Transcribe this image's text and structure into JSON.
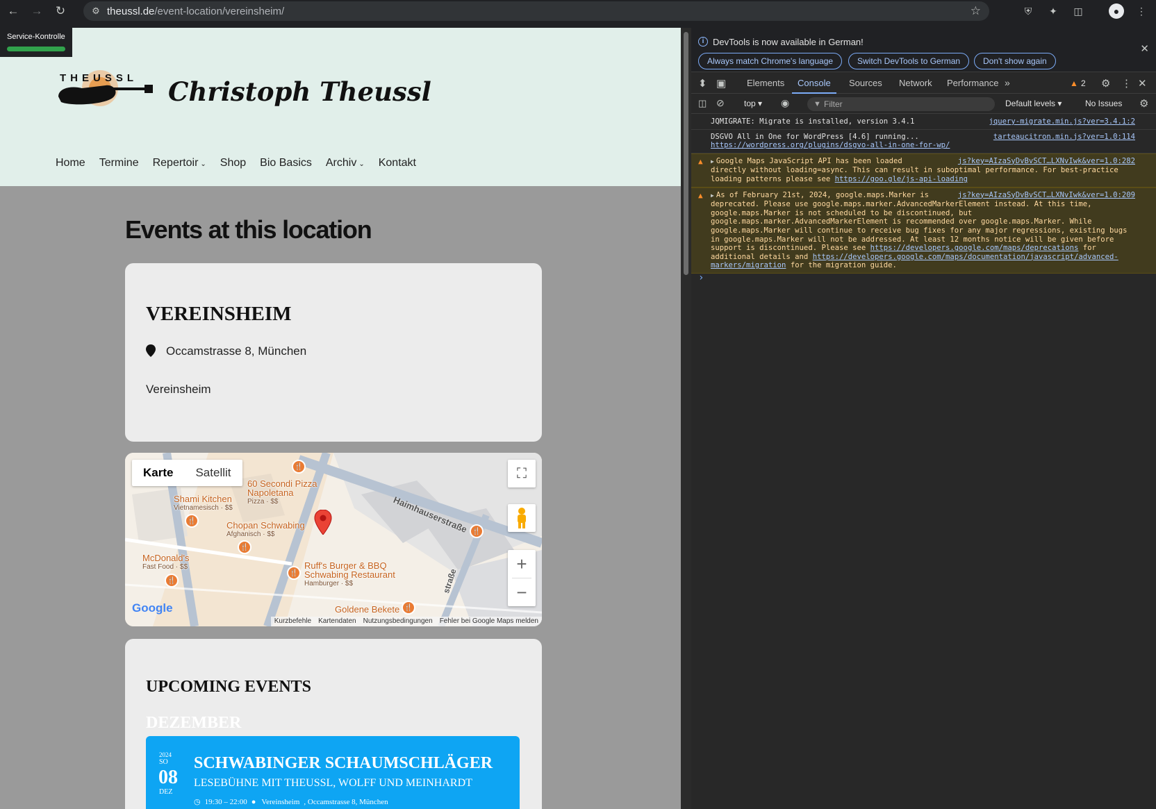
{
  "browser": {
    "url_host": "theussl.de",
    "url_path": "/event-location/vereinsheim/"
  },
  "service_control": {
    "label": "Service-Kontrolle"
  },
  "site": {
    "logo_text": "THEUSSL",
    "title": "Christoph Theussl",
    "nav": [
      "Home",
      "Termine",
      "Repertoir",
      "Shop",
      "Bio Basics",
      "Archiv",
      "Kontakt"
    ]
  },
  "page": {
    "heading": "Events at this location",
    "location": {
      "name": "VEREINSHEIM",
      "address": "Occamstrasse 8, München",
      "description": "Vereinsheim"
    },
    "map": {
      "type_map": "Karte",
      "type_satellite": "Satellit",
      "street": "Haimhauserstraße",
      "street2": "straße",
      "pois": [
        {
          "name": "60 Secondi Pizza",
          "name2": "Napoletana",
          "sub": "Pizza · $$"
        },
        {
          "name": "Shami Kitchen",
          "sub": "Vietnamesisch · $$"
        },
        {
          "name": "Chopan Schwabing",
          "sub": "Afghanisch · $$"
        },
        {
          "name": "McDonald's",
          "sub": "Fast Food · $$"
        },
        {
          "name": "Ruff's Burger & BBQ",
          "name2": "Schwabing Restaurant",
          "sub": "Hamburger · $$"
        },
        {
          "name": "Goldene Bekete"
        }
      ],
      "google": "Google",
      "footer": [
        "Kurzbefehle",
        "Kartendaten",
        "Nutzungsbedingungen",
        "Fehler bei Google Maps melden"
      ]
    },
    "upcoming": {
      "heading": "UPCOMING EVENTS",
      "month": "DEZEMBER",
      "event": {
        "year": "2024",
        "weekday": "SO",
        "day": "08",
        "month": "DEZ",
        "title": "SCHWABINGER SCHAUMSCHLÄGER",
        "subtitle": "LESEBÜHNE MIT THEUSSL, WOLFF UND MEINHARDT",
        "time": "19:30 – 22:00",
        "venue": "Vereinsheim",
        "address": ", Occamstrasse 8, München"
      }
    }
  },
  "devtools": {
    "info": {
      "text": "DevTools is now available in German!",
      "btn1": "Always match Chrome's language",
      "btn2": "Switch DevTools to German",
      "btn3": "Don't show again"
    },
    "tabs": [
      "Elements",
      "Console",
      "Sources",
      "Network",
      "Performance"
    ],
    "active_tab": "Console",
    "warning_count": "2",
    "toolbar": {
      "context": "top",
      "filter_placeholder": "Filter",
      "levels": "Default levels",
      "issues": "No Issues"
    },
    "messages": [
      {
        "text": "JQMIGRATE: Migrate is installed, version 3.4.1",
        "src": "jquery-migrate.min.js?ver=3.4.1:2"
      },
      {
        "text": "DSGVO All in One for WordPress [4.6] running...",
        "link": "https://wordpress.org/plugins/dsgvo-all-in-one-for-wp/",
        "src": "tarteaucitron.min.js?ver=1.0:114"
      },
      {
        "text1": "Google Maps JavaScript API has been loaded",
        "text2": "directly without loading=async. This can result in suboptimal performance. For best-practice loading patterns please see",
        "link": "https://goo.gle/js-api-loading",
        "src": "js?key=AIzaSyDvBvSCT…LXNvIwk&ver=1.0:282"
      },
      {
        "text1": "As of February 21st, 2024, google.maps.Marker is",
        "text2": "deprecated. Please use google.maps.marker.AdvancedMarkerElement instead. At this time, google.maps.Marker is not scheduled to be discontinued, but google.maps.marker.AdvancedMarkerElement is recommended over google.maps.Marker. While google.maps.Marker will continue to receive bug fixes for any major regressions, existing bugs in google.maps.Marker will not be addressed. At least 12 months notice will be given before support is discontinued. Please see",
        "link1": "https://developers.google.com/maps/deprecations",
        "text3": "for additional details and",
        "link2": "https://developers.google.com/maps/documentation/javascript/advanced-markers/migration",
        "text4": "for the migration guide.",
        "src": "js?key=AIzaSyDvBvSCT…LXNvIwk&ver=1.0:209"
      }
    ]
  }
}
